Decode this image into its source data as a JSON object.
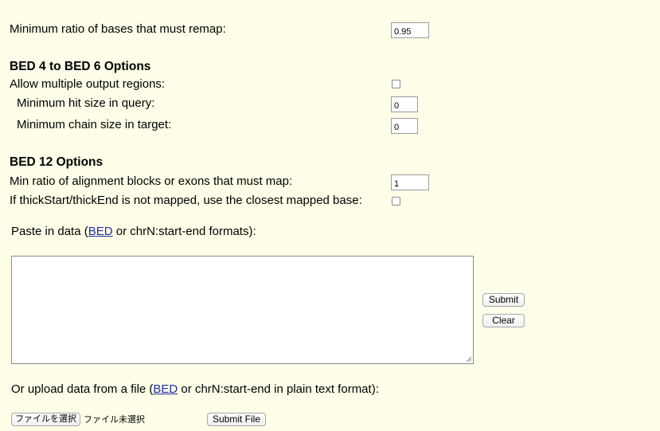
{
  "min_ratio": {
    "label": "Minimum ratio of bases that must remap:",
    "value": "0.95"
  },
  "bed4_section": {
    "heading": "BED 4 to BED 6 Options",
    "allow_multiple_label": "Allow multiple output regions:",
    "allow_multiple_checked": false,
    "min_hit_label": "Minimum hit size in query:",
    "min_hit_value": "0",
    "min_chain_label": "Minimum chain size in target:",
    "min_chain_value": "0"
  },
  "bed12_section": {
    "heading": "BED 12 Options",
    "min_ratio_blocks_label": "Min ratio of alignment blocks or exons that must map:",
    "min_ratio_blocks_value": "1",
    "thick_label": "If thickStart/thickEnd is not mapped, use the closest mapped base:",
    "thick_checked": false
  },
  "paste": {
    "prefix": "Paste in data (",
    "link": "BED",
    "suffix": " or chrN:start-end formats):",
    "value": ""
  },
  "buttons": {
    "submit": "Submit",
    "clear": "Clear"
  },
  "upload": {
    "prefix": "Or upload data from a file (",
    "link": "BED",
    "suffix": " or chrN:start-end in plain text format):",
    "choose_file": "ファイルを選択",
    "no_file": "ファイル未選択",
    "submit_file": "Submit File"
  }
}
